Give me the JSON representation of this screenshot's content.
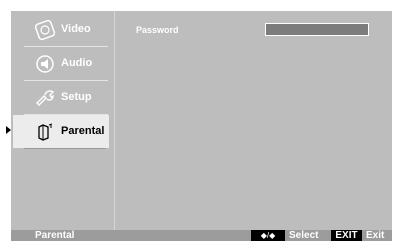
{
  "menu": {
    "items": [
      {
        "label": "Video",
        "icon": "video-icon"
      },
      {
        "label": "Audio",
        "icon": "audio-icon"
      },
      {
        "label": "Setup",
        "icon": "setup-icon"
      },
      {
        "label": "Parental",
        "icon": "parental-icon",
        "selected": true
      }
    ]
  },
  "content": {
    "password_label": "Password",
    "password_value": ""
  },
  "footer": {
    "section_title": "Parental",
    "nav_key": "◆/◆",
    "select_label": "Select",
    "exit_key": "EXIT",
    "exit_label": "Exit"
  },
  "colors": {
    "background": "#bdbdbd",
    "selected_item": "#ececec",
    "footer_bar": "#9c9c9c",
    "password_field": "#7c7c7c"
  }
}
